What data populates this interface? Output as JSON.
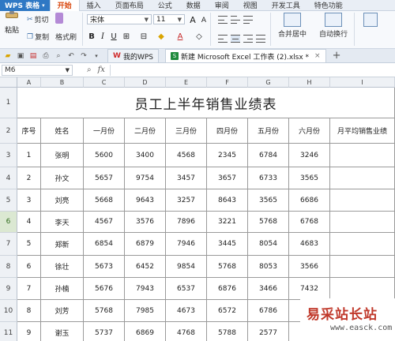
{
  "app": {
    "name": "WPS 表格"
  },
  "menu": [
    "开始",
    "插入",
    "页面布局",
    "公式",
    "数据",
    "审阅",
    "视图",
    "开发工具",
    "特色功能"
  ],
  "ribbon": {
    "paste": "粘贴",
    "cut": "剪切",
    "copy": "复制",
    "format_painter": "格式刷",
    "font_name": "宋体",
    "font_size": "11",
    "merge_center": "合并居中",
    "auto_wrap": "自动换行"
  },
  "tabs": [
    {
      "label": "我的WPS"
    },
    {
      "label": "新建 Microsoft Excel 工作表 (2).xlsx *"
    }
  ],
  "formula_bar": {
    "cell_ref": "M6",
    "fx": "fx",
    "value": ""
  },
  "sheet": {
    "columns": [
      "A",
      "B",
      "C",
      "D",
      "E",
      "F",
      "G",
      "H",
      "I"
    ],
    "rows": [
      "1",
      "2",
      "3",
      "4",
      "5",
      "6",
      "7",
      "8",
      "9",
      "10",
      "11"
    ],
    "selected_row": "6",
    "title": "员工上半年销售业绩表",
    "headers": [
      "序号",
      "姓名",
      "一月份",
      "二月份",
      "三月份",
      "四月份",
      "五月份",
      "六月份",
      "月平均销售业绩"
    ],
    "data": [
      [
        "1",
        "张明",
        "5600",
        "3400",
        "4568",
        "2345",
        "6784",
        "3246",
        ""
      ],
      [
        "2",
        "孙文",
        "5657",
        "9754",
        "3457",
        "3657",
        "6733",
        "3565",
        ""
      ],
      [
        "3",
        "刘亮",
        "5668",
        "9643",
        "3257",
        "8643",
        "3565",
        "6686",
        ""
      ],
      [
        "4",
        "李天",
        "4567",
        "3576",
        "7896",
        "3221",
        "5768",
        "6768",
        ""
      ],
      [
        "5",
        "郑新",
        "6854",
        "6879",
        "7946",
        "3445",
        "8054",
        "4683",
        ""
      ],
      [
        "6",
        "徐壮",
        "5673",
        "6452",
        "9854",
        "5768",
        "8053",
        "3566",
        ""
      ],
      [
        "7",
        "孙楠",
        "5676",
        "7943",
        "6537",
        "6876",
        "3466",
        "7432",
        ""
      ],
      [
        "8",
        "刘芳",
        "5768",
        "7985",
        "4673",
        "6572",
        "6786",
        "",
        ""
      ],
      [
        "9",
        "谢玉",
        "5737",
        "6869",
        "4768",
        "5788",
        "2577",
        "",
        ""
      ]
    ]
  },
  "watermark": {
    "text": "易采站长站",
    "url": "www.easck.com"
  }
}
